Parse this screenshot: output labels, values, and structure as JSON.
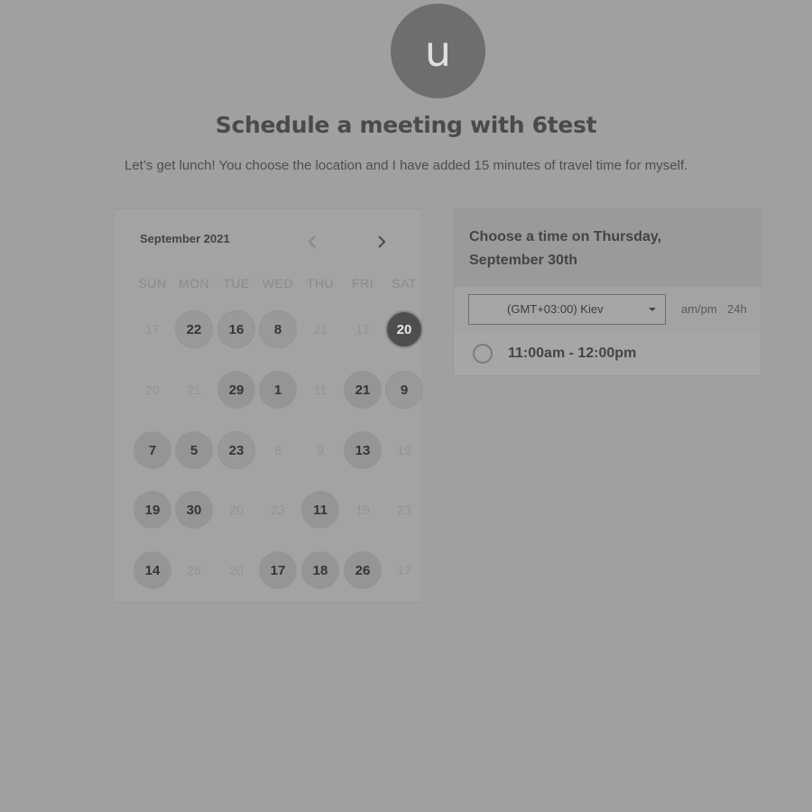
{
  "avatar": {
    "initial": "u"
  },
  "header": {
    "title": "Schedule a meeting with 6test",
    "subtitle": "Let’s get lunch! You choose the location and I have added 15 minutes of travel time for myself."
  },
  "calendar": {
    "month": "September 2021",
    "prev_icon": "chevron-left-icon",
    "next_icon": "chevron-right-icon",
    "weekdays": [
      "SUN",
      "MON",
      "TUE",
      "WED",
      "THU",
      "FRI",
      "SAT"
    ],
    "weeks": [
      [
        {
          "d": "17",
          "s": "off"
        },
        {
          "d": "22",
          "s": "dotted"
        },
        {
          "d": "16",
          "s": "dotted"
        },
        {
          "d": "8",
          "s": "dotted"
        },
        {
          "d": "21",
          "s": "off"
        },
        {
          "d": "17",
          "s": "off"
        },
        {
          "d": "20",
          "s": "selected"
        }
      ],
      [
        {
          "d": "20",
          "s": "off"
        },
        {
          "d": "21",
          "s": "off"
        },
        {
          "d": "29",
          "s": "avail"
        },
        {
          "d": "1",
          "s": "avail"
        },
        {
          "d": "11",
          "s": "off"
        },
        {
          "d": "21",
          "s": "avail"
        },
        {
          "d": "9",
          "s": "dotted"
        }
      ],
      [
        {
          "d": "7",
          "s": "avail"
        },
        {
          "d": "5",
          "s": "avail"
        },
        {
          "d": "23",
          "s": "dotted"
        },
        {
          "d": "8",
          "s": "off"
        },
        {
          "d": "9",
          "s": "off"
        },
        {
          "d": "13",
          "s": "avail"
        },
        {
          "d": "19",
          "s": "off"
        }
      ],
      [
        {
          "d": "19",
          "s": "avail"
        },
        {
          "d": "30",
          "s": "avail"
        },
        {
          "d": "20",
          "s": "off"
        },
        {
          "d": "23",
          "s": "off"
        },
        {
          "d": "11",
          "s": "avail"
        },
        {
          "d": "19",
          "s": "off"
        },
        {
          "d": "23",
          "s": "off"
        }
      ],
      [
        {
          "d": "14",
          "s": "avail"
        },
        {
          "d": "25",
          "s": "off"
        },
        {
          "d": "20",
          "s": "off"
        },
        {
          "d": "17",
          "s": "avail"
        },
        {
          "d": "18",
          "s": "avail"
        },
        {
          "d": "26",
          "s": "avail"
        },
        {
          "d": "17",
          "s": "off"
        }
      ]
    ]
  },
  "times": {
    "heading_line1": "Choose a time on Thursday,",
    "heading_line2": "September 30th",
    "timezone": "(GMT+03:00) Kiev",
    "format_ampm": "am/pm",
    "format_24h": "24h",
    "slots": [
      {
        "label": "11:00am - 12:00pm"
      }
    ]
  },
  "colors": {
    "background": "#a0a0a0",
    "selected_day": "#4e4e4e",
    "available_day": "#959595"
  }
}
